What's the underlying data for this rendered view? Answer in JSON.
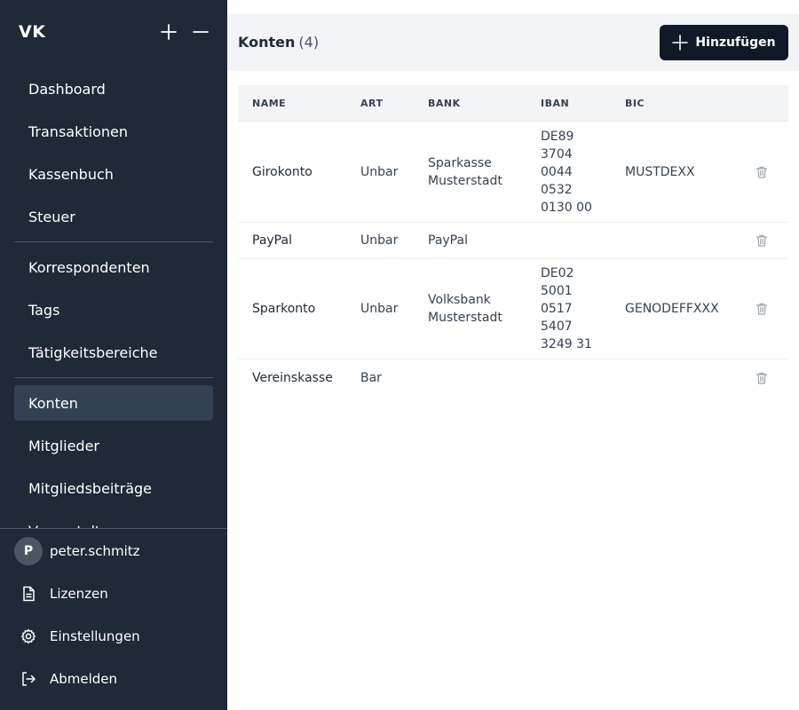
{
  "sidebar": {
    "logo": "VK",
    "nav_groups": [
      [
        {
          "label": "Dashboard"
        },
        {
          "label": "Transaktionen"
        },
        {
          "label": "Kassenbuch"
        },
        {
          "label": "Steuer"
        }
      ],
      [
        {
          "label": "Korrespondenten"
        },
        {
          "label": "Tags"
        },
        {
          "label": "Tätigkeitsbereiche"
        }
      ],
      [
        {
          "label": "Konten",
          "active": true
        },
        {
          "label": "Mitglieder"
        },
        {
          "label": "Mitgliedsbeiträge"
        },
        {
          "label": "Veranstaltungen"
        }
      ]
    ],
    "user": {
      "initial": "P",
      "name": "peter.schmitz"
    },
    "footer_items": [
      {
        "label": "Lizenzen",
        "icon": "document-icon"
      },
      {
        "label": "Einstellungen",
        "icon": "gear-icon"
      },
      {
        "label": "Abmelden",
        "icon": "logout-icon"
      }
    ]
  },
  "main": {
    "title": "Konten",
    "count": "(4)",
    "add_label": "Hinzufügen",
    "table": {
      "columns": [
        "NAME",
        "ART",
        "BANK",
        "IBAN",
        "BIC"
      ],
      "rows": [
        {
          "name": "Girokonto",
          "art": "Unbar",
          "bank": "Sparkasse\nMusterstadt",
          "iban": "DE89\n3704\n0044\n0532\n0130 00",
          "bic": "MUSTDEXX"
        },
        {
          "name": "PayPal",
          "art": "Unbar",
          "bank": "PayPal",
          "iban": "",
          "bic": ""
        },
        {
          "name": "Sparkonto",
          "art": "Unbar",
          "bank": "Volksbank\nMusterstadt",
          "iban": "DE02\n5001\n0517\n5407\n3249 31",
          "bic": "GENODEFFXXX"
        },
        {
          "name": "Vereinskasse",
          "art": "Bar",
          "bank": "",
          "iban": "",
          "bic": ""
        }
      ]
    }
  },
  "colors": {
    "sidebar_bg": "#1f2937",
    "active_item_bg": "#334155",
    "primary_button": "#111827"
  }
}
